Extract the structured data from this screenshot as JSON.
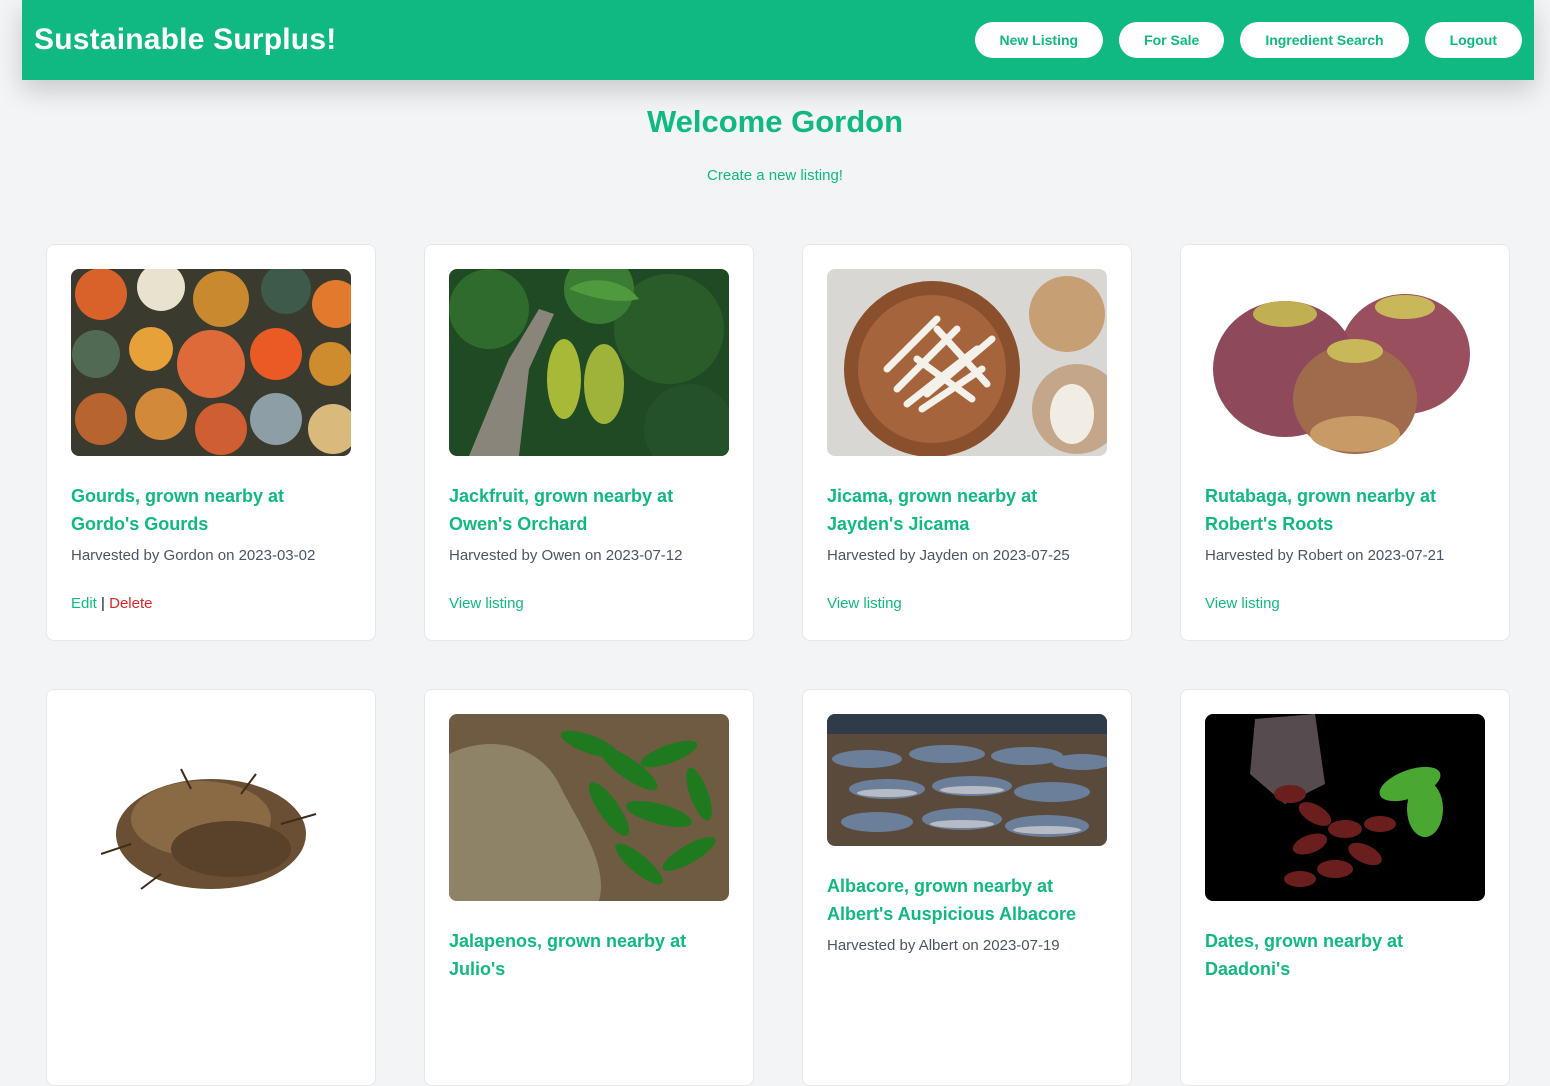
{
  "brand": "Sustainable Surplus!",
  "nav": {
    "new_listing": "New Listing",
    "for_sale": "For Sale",
    "ingredient_search": "Ingredient Search",
    "logout": "Logout"
  },
  "welcome": "Welcome Gordon",
  "create_link": "Create a new listing!",
  "colors": {
    "accent": "#10b981",
    "danger": "#dc2626"
  },
  "cards": [
    {
      "title": "Gourds, grown nearby at Gordo's Gourds",
      "harvest": "Harvested by Gordon on 2023-03-02",
      "edit": "Edit",
      "delete": "Delete",
      "image": "gourds-photo"
    },
    {
      "title": "Jackfruit, grown nearby at Owen's Orchard",
      "harvest": "Harvested by Owen on 2023-07-12",
      "view": "View listing",
      "image": "jackfruit-photo"
    },
    {
      "title": "Jicama, grown nearby at Jayden's Jicama",
      "harvest": "Harvested by Jayden on 2023-07-25",
      "view": "View listing",
      "image": "jicama-photo"
    },
    {
      "title": "Rutabaga, grown nearby at Robert's Roots",
      "harvest": "Harvested by Robert on 2023-07-21",
      "view": "View listing",
      "image": "rutabaga-photo"
    },
    {
      "title": "",
      "harvest": "",
      "image": "crickets-photo"
    },
    {
      "title": "Jalapenos, grown nearby at Julio's",
      "harvest": "",
      "image": "jalapenos-photo"
    },
    {
      "title": "Albacore, grown nearby at Albert's Auspicious Albacore",
      "harvest": "Harvested by Albert on 2023-07-19",
      "image": "albacore-photo"
    },
    {
      "title": "Dates, grown nearby at Daadoni's",
      "harvest": "",
      "image": "dates-photo"
    }
  ]
}
